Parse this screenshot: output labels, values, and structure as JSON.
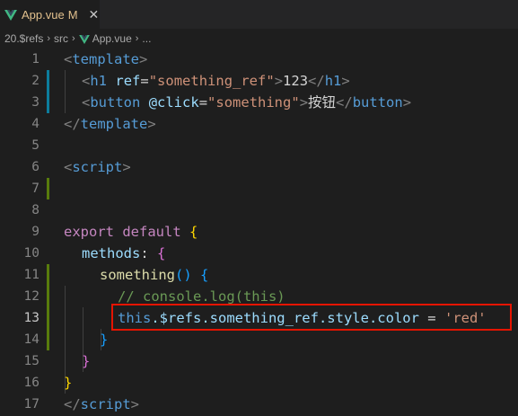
{
  "tab": {
    "filename": "App.vue",
    "status": "M",
    "close": "✕"
  },
  "breadcrumb": {
    "folder": "20.$refs",
    "sub": "src",
    "file": "App.vue",
    "more": "...",
    "sep": "›"
  },
  "editor": {
    "line_numbers": [
      "1",
      "2",
      "3",
      "4",
      "5",
      "6",
      "7",
      "8",
      "9",
      "10",
      "11",
      "12",
      "13",
      "14",
      "15",
      "16",
      "17"
    ],
    "active_line": "13",
    "lines": {
      "l1": [
        "<",
        "template",
        ">"
      ],
      "l2": [
        "<",
        "h1",
        "ref",
        "=",
        "\"something_ref\"",
        ">",
        "123",
        "</",
        "h1",
        ">"
      ],
      "l3": [
        "<",
        "button",
        "@click",
        "=",
        "\"something\"",
        ">",
        "按钮",
        "</",
        "button",
        ">"
      ],
      "l4": [
        "</",
        "template",
        ">"
      ],
      "l6": [
        "<",
        "script",
        ">"
      ],
      "l9": [
        "export",
        "default",
        "{"
      ],
      "l10": [
        "methods",
        ":",
        "{"
      ],
      "l11": [
        "something",
        "()",
        "{"
      ],
      "l12": "// console.log(this)",
      "l13": [
        "this",
        ".$refs.something_ref.style.color",
        "=",
        "'red'"
      ],
      "l14": "}",
      "l15": "}",
      "l16": "}",
      "l17": [
        "</",
        "script",
        ">"
      ]
    }
  },
  "colors": {
    "highlight_border": "#e51400",
    "vue_green": "#41b883",
    "vue_dark": "#34495e",
    "modified_bar": "#0c7d9d",
    "added_bar": "#587c0c"
  }
}
